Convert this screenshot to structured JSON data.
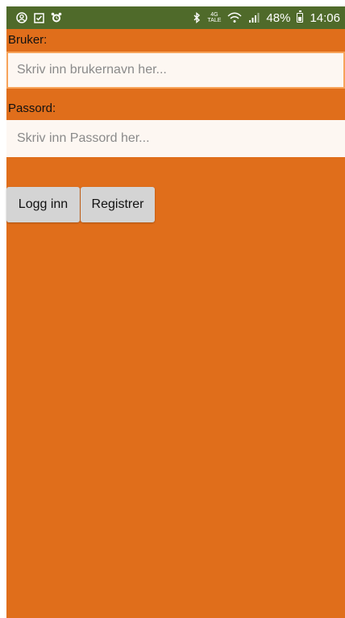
{
  "status_bar": {
    "network_top": "4G",
    "network_bottom": "TALE",
    "battery": "48%",
    "time": "14:06"
  },
  "form": {
    "user_label": "Bruker:",
    "user_placeholder": "Skriv inn brukernavn her...",
    "password_label": "Passord:",
    "password_placeholder": "Skriv inn Passord her...",
    "login_button": "Logg inn",
    "register_button": "Registrer"
  },
  "colors": {
    "status_bar": "#4f6a2a",
    "background": "#e06e1b",
    "input_bg": "#fdf7f2",
    "focus_border": "#f7a35a",
    "button_bg": "#d4d4d4"
  }
}
